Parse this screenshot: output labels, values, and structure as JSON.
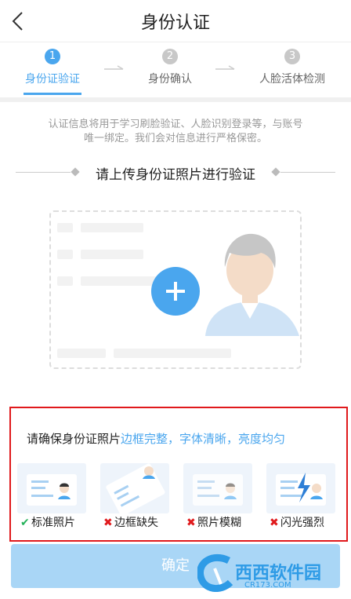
{
  "header": {
    "title": "身份认证",
    "back_icon": "chevron-left-icon"
  },
  "steps": [
    {
      "num": "1",
      "label": "身份证验证",
      "state": "active"
    },
    {
      "num": "2",
      "label": "身份确认",
      "state": "inactive"
    },
    {
      "num": "3",
      "label": "人脸活体检测",
      "state": "inactive"
    }
  ],
  "notice": {
    "line1": "认证信息将用于学习刷脸验证、人脸识别登录等，与账号",
    "line2": "唯一绑定。我们会对信息进行严格保密。"
  },
  "upload": {
    "subtitle": "请上传身份证照片进行验证",
    "add_icon": "plus-icon"
  },
  "requirements": {
    "lead": "请确保身份证照片",
    "highlight": "边框完整，字体清晰，亮度均匀",
    "examples": [
      {
        "label": "标准照片",
        "status": "ok"
      },
      {
        "label": "边框缺失",
        "status": "bad"
      },
      {
        "label": "照片模糊",
        "status": "bad"
      },
      {
        "label": "闪光强烈",
        "status": "bad"
      }
    ]
  },
  "confirm": {
    "label": "确定"
  },
  "watermark": {
    "text": "西西软件园",
    "sub": "CR173.COM"
  },
  "colors": {
    "accent": "#4aa6ee",
    "alert": "#e0191c",
    "ok": "#25b25a",
    "button_disabled": "#a9d6f6"
  }
}
